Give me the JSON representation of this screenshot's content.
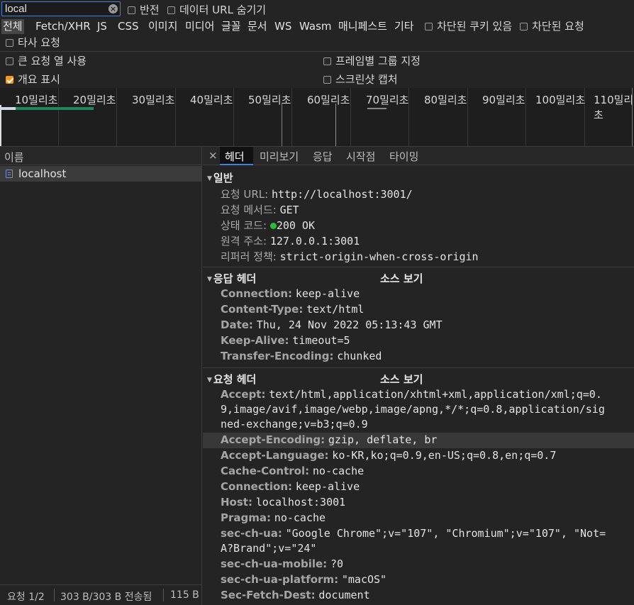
{
  "toolbar": {
    "search_value": "local",
    "invert_label": "반전",
    "hide_data_url_label": "데이터 URL 숨기기",
    "types": [
      "전체",
      "Fetch/XHR",
      "JS",
      "CSS",
      "이미지",
      "미디어",
      "글꼴",
      "문서",
      "WS",
      "Wasm",
      "매니페스트",
      "기타"
    ],
    "blocked_cookies_label": "차단된 쿠키 있음",
    "blocked_requests_label": "차단된 요청",
    "third_party_label": "타사 요청"
  },
  "settings": {
    "big_rows": "큰 요청 열 사용",
    "group_by_frame": "프레임별 그룹 지정",
    "overview": "개요 표시",
    "screenshots": "스크린샷 캡처"
  },
  "timeline": {
    "ticks": [
      "10밀리초",
      "20밀리초",
      "30밀리초",
      "40밀리초",
      "50밀리초",
      "60밀리초",
      "70밀리초",
      "80밀리초",
      "90밀리초",
      "100밀리초",
      "110밀리초"
    ]
  },
  "request_list": {
    "column_name": "이름",
    "items": [
      "localhost"
    ],
    "status": {
      "requests": "요청 1/2",
      "transferred": "303 B/303 B 전송됨",
      "resources": "115 B"
    }
  },
  "details": {
    "close": "×",
    "tabs": [
      "헤더",
      "미리보기",
      "응답",
      "시작점",
      "타이밍"
    ],
    "general": {
      "title": "일반",
      "rows": [
        {
          "k": "요청 URL:",
          "v": "http://localhost:3001/"
        },
        {
          "k": "요청 메서드:",
          "v": "GET"
        },
        {
          "k": "상태 코드:",
          "v": "200 OK"
        },
        {
          "k": "원격 주소:",
          "v": "127.0.0.1:3001"
        },
        {
          "k": "리퍼러 정책:",
          "v": "strict-origin-when-cross-origin"
        }
      ]
    },
    "response_headers": {
      "title": "응답 헤더",
      "view_source": "소스 보기",
      "rows": [
        {
          "k": "Connection:",
          "v": "keep-alive"
        },
        {
          "k": "Content-Type:",
          "v": "text/html"
        },
        {
          "k": "Date:",
          "v": "Thu, 24 Nov 2022 05:13:43 GMT"
        },
        {
          "k": "Keep-Alive:",
          "v": "timeout=5"
        },
        {
          "k": "Transfer-Encoding:",
          "v": "chunked"
        }
      ]
    },
    "request_headers": {
      "title": "요청 헤더",
      "view_source": "소스 보기",
      "accept_k": "Accept:",
      "accept_v1": "text/html,application/xhtml+xml,application/xml;q=0.",
      "accept_v2": "9,image/avif,image/webp,image/apng,*/*;q=0.8,application/sig",
      "accept_v3": "ned-exchange;v=b3;q=0.9",
      "rows": [
        {
          "k": "Accept-Encoding:",
          "v": "gzip, deflate, br"
        },
        {
          "k": "Accept-Language:",
          "v": "ko-KR,ko;q=0.9,en-US;q=0.8,en;q=0.7"
        },
        {
          "k": "Cache-Control:",
          "v": "no-cache"
        },
        {
          "k": "Connection:",
          "v": "keep-alive"
        },
        {
          "k": "Host:",
          "v": "localhost:3001"
        },
        {
          "k": "Pragma:",
          "v": "no-cache"
        }
      ],
      "sec_ch_ua_k": "sec-ch-ua:",
      "sec_ch_ua_v1": "\"Google Chrome\";v=\"107\", \"Chromium\";v=\"107\", \"Not=",
      "sec_ch_ua_v2": "A?Brand\";v=\"24\"",
      "rows2": [
        {
          "k": "sec-ch-ua-mobile:",
          "v": "?0"
        },
        {
          "k": "sec-ch-ua-platform:",
          "v": "\"macOS\""
        },
        {
          "k": "Sec-Fetch-Dest:",
          "v": "document"
        }
      ]
    }
  },
  "colors": {
    "accent": "#3d82d6",
    "status_green": "#2bbd3a",
    "checkbox_orange": "#f29b20"
  }
}
